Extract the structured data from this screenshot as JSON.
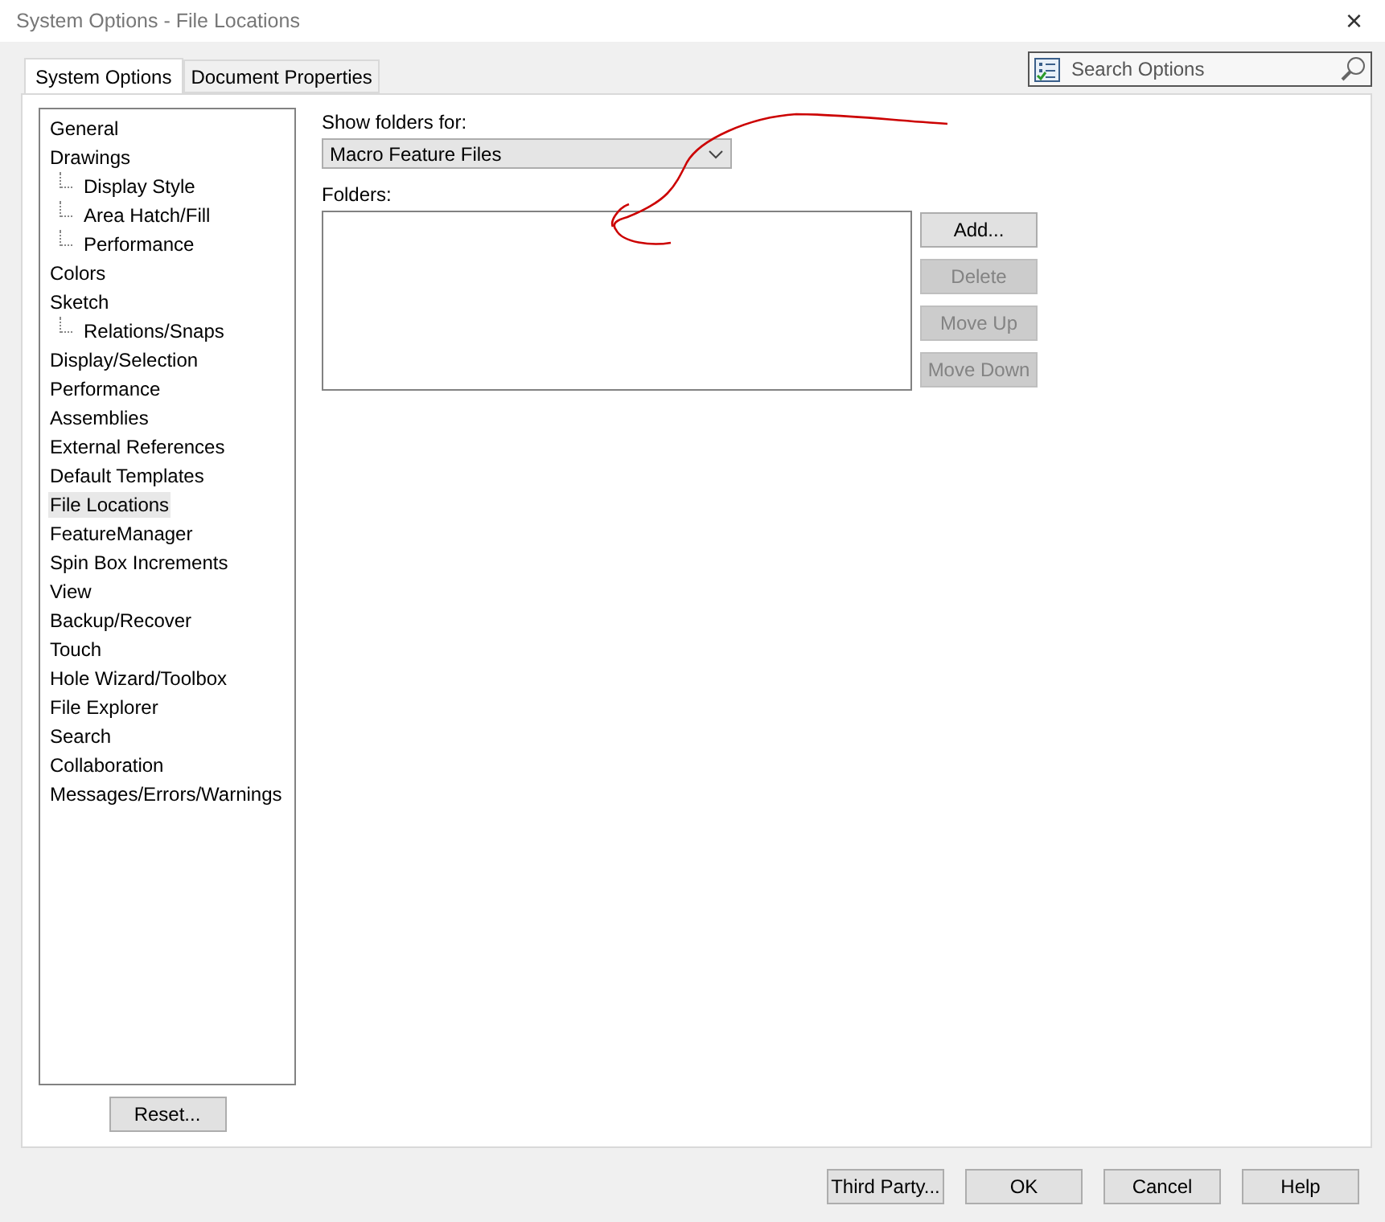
{
  "window": {
    "title": "System Options - File Locations",
    "close": "×"
  },
  "tabs": [
    {
      "label": "System Options",
      "selected": true
    },
    {
      "label": "Document Properties",
      "selected": false
    }
  ],
  "search": {
    "placeholder": "Search Options"
  },
  "tree": [
    {
      "label": "General",
      "selected": false
    },
    {
      "label": "Drawings",
      "selected": false,
      "children": [
        {
          "label": "Display Style",
          "selected": false
        },
        {
          "label": "Area Hatch/Fill",
          "selected": false
        },
        {
          "label": "Performance",
          "selected": false
        }
      ]
    },
    {
      "label": "Colors",
      "selected": false
    },
    {
      "label": "Sketch",
      "selected": false,
      "children": [
        {
          "label": "Relations/Snaps",
          "selected": false
        }
      ]
    },
    {
      "label": "Display/Selection",
      "selected": false
    },
    {
      "label": "Performance",
      "selected": false
    },
    {
      "label": "Assemblies",
      "selected": false
    },
    {
      "label": "External References",
      "selected": false
    },
    {
      "label": "Default Templates",
      "selected": false
    },
    {
      "label": "File Locations",
      "selected": true
    },
    {
      "label": "FeatureManager",
      "selected": false
    },
    {
      "label": "Spin Box Increments",
      "selected": false
    },
    {
      "label": "View",
      "selected": false
    },
    {
      "label": "Backup/Recover",
      "selected": false
    },
    {
      "label": "Touch",
      "selected": false
    },
    {
      "label": "Hole Wizard/Toolbox",
      "selected": false
    },
    {
      "label": "File Explorer",
      "selected": false
    },
    {
      "label": "Search",
      "selected": false
    },
    {
      "label": "Collaboration",
      "selected": false
    },
    {
      "label": "Messages/Errors/Warnings",
      "selected": false
    }
  ],
  "reset_button": "Reset...",
  "show_folders_for": {
    "label": "Show folders for:",
    "value": "Macro Feature Files"
  },
  "folders": {
    "label": "Folders:"
  },
  "folder_buttons": [
    {
      "label": "Add...",
      "disabled": false
    },
    {
      "label": "Delete",
      "disabled": true
    },
    {
      "label": "Move Up",
      "disabled": true
    },
    {
      "label": "Move Down",
      "disabled": true
    }
  ],
  "buttons": [
    "Third Party...",
    "OK",
    "Cancel",
    "Help"
  ]
}
